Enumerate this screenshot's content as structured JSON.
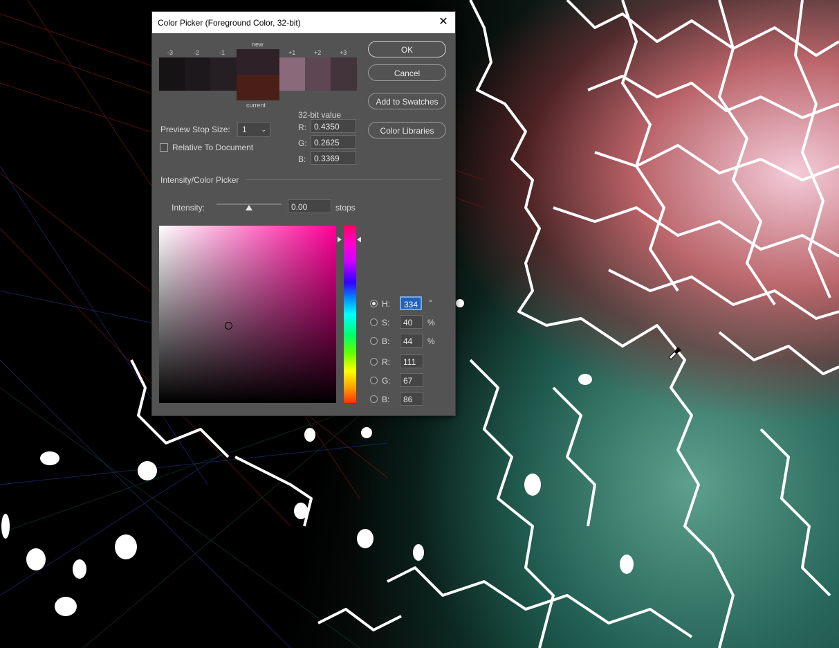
{
  "dialog": {
    "title": "Color Picker (Foreground Color, 32-bit)",
    "close_glyph": "✕"
  },
  "stops": {
    "labels": [
      "-3",
      "-2",
      "-1",
      "+1",
      "+2",
      "+3"
    ],
    "new_label": "new",
    "current_label": "current",
    "colors": {
      "m3": "#161315",
      "m2": "#1d181b",
      "m1": "#251f23",
      "new": "#2e2228",
      "current": "#4a1f18",
      "p1": "#8a6a7a",
      "p2": "#5e4652",
      "p3": "#43343c"
    }
  },
  "buttons": {
    "ok": "OK",
    "cancel": "Cancel",
    "add_swatches": "Add to Swatches",
    "color_libraries": "Color Libraries"
  },
  "preview": {
    "label": "Preview Stop Size:",
    "value": "1",
    "relative_label": "Relative To Document",
    "relative_checked": false
  },
  "value32": {
    "title": "32-bit value",
    "r_label": "R:",
    "r": "0.4350",
    "g_label": "G:",
    "g": "0.2625",
    "b_label": "B:",
    "b": "0.3369"
  },
  "intensity": {
    "section_title": "Intensity/Color Picker",
    "label": "Intensity:",
    "value": "0.00",
    "unit": "stops",
    "slider_fraction": 0.5
  },
  "hsb": {
    "h_label": "H:",
    "h": "334",
    "h_unit": "°",
    "s_label": "S:",
    "s": "40",
    "s_unit": "%",
    "b_label": "B:",
    "b": "44",
    "b_unit": "%",
    "selected": "H"
  },
  "rgb": {
    "r_label": "R:",
    "r": "111",
    "g_label": "G:",
    "g": "67",
    "b_label": "B:",
    "b": "86"
  },
  "icons": {
    "eyedropper": "eyedropper-icon"
  }
}
